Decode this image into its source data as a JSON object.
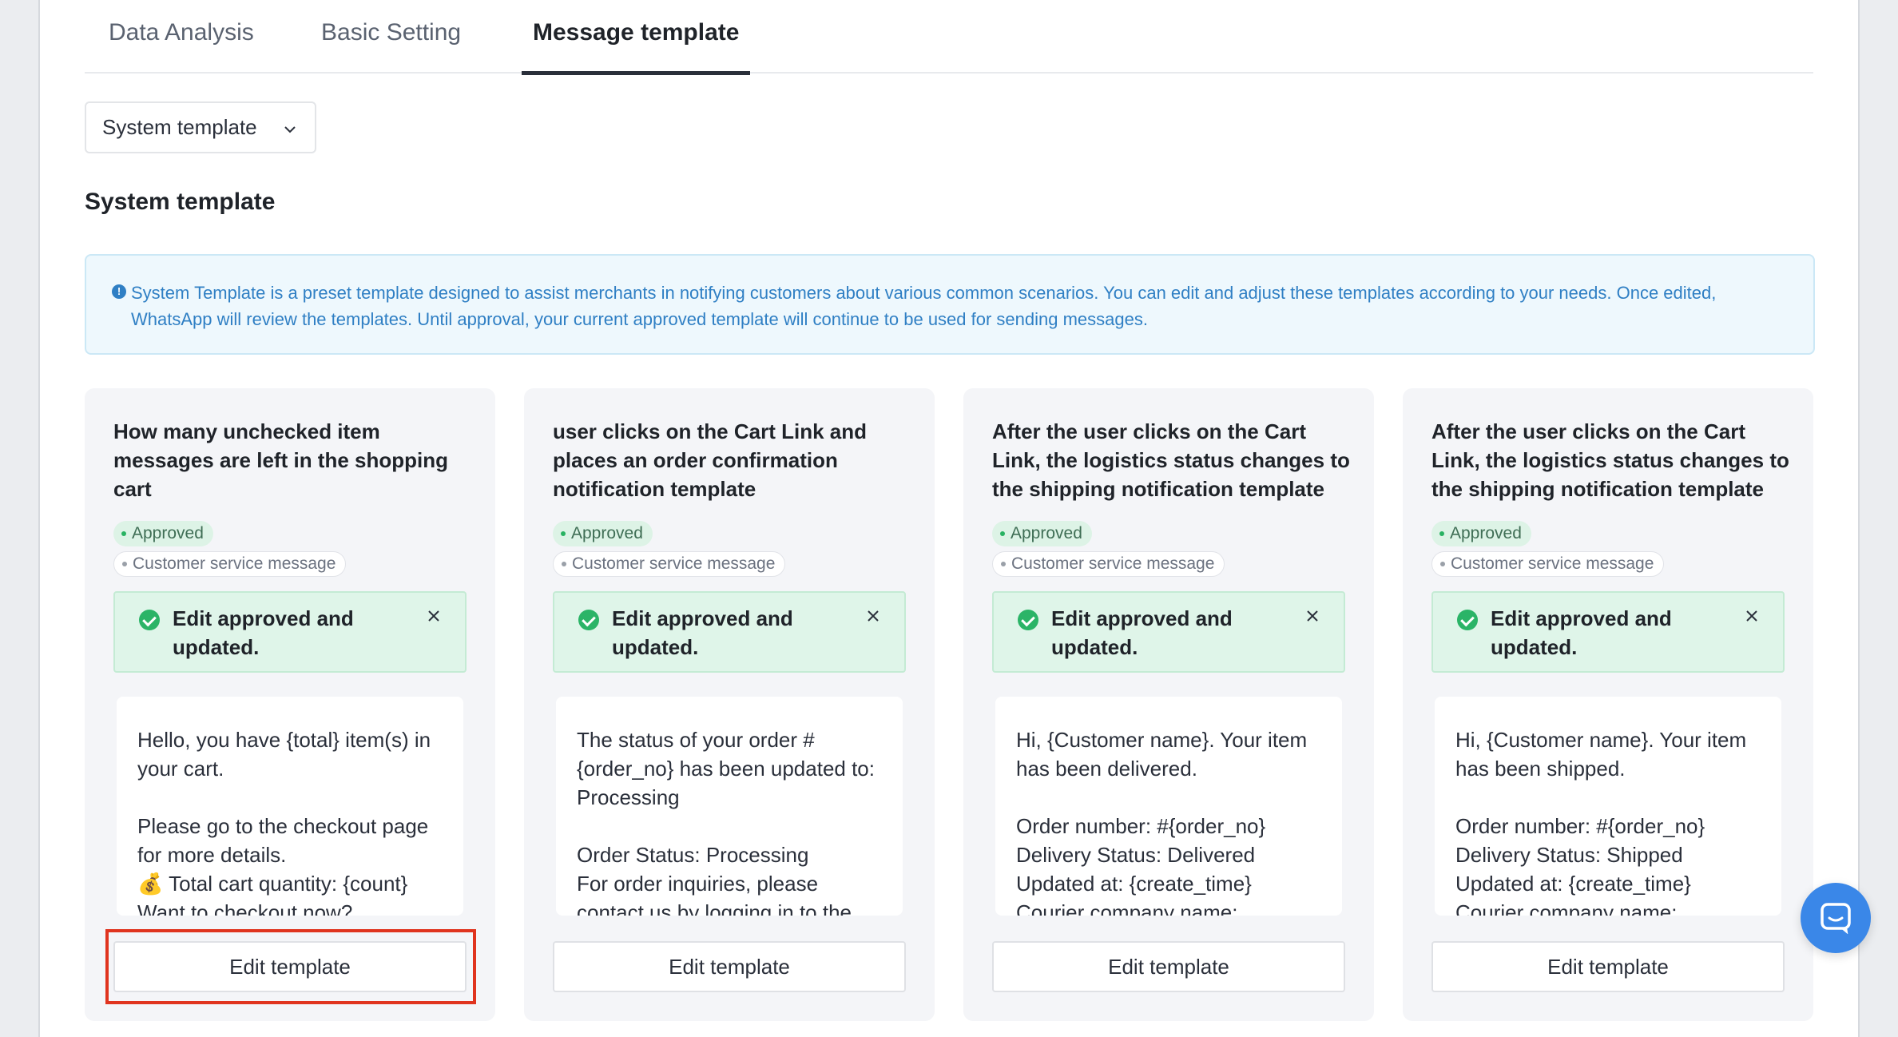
{
  "tabs": [
    {
      "label": "Data Analysis"
    },
    {
      "label": "Basic Setting"
    },
    {
      "label": "Message template"
    }
  ],
  "active_tab": "Message template",
  "template_select": {
    "value": "System template"
  },
  "section_title": "System template",
  "notice": {
    "text": "System Template is a preset template designed to assist merchants in notifying customers about various common scenarios. You can edit and adjust these templates according to your needs. Once edited, WhatsApp will review the templates. Until approval, your current approved template will continue to be used for sending messages."
  },
  "cards": [
    {
      "title": "How many unchecked item messages are left in the shopping cart",
      "status_tag": "Approved",
      "category_tag": "Customer service message",
      "alert": "Edit approved and updated.",
      "message": "Hello, you have {total} item(s) in your cart.\n\nPlease go to the checkout page for more details.\n💰 Total cart quantity: {count}\nWant to checkout now?",
      "button": "Edit template"
    },
    {
      "title": "user clicks on the Cart Link and places an order confirmation notification template",
      "status_tag": "Approved",
      "category_tag": "Customer service message",
      "alert": "Edit approved and updated.",
      "message": "The status of your order #{order_no} has been updated to: Processing\n\nOrder Status: Processing\nFor order inquiries, please contact us by logging in to the",
      "button": "Edit template"
    },
    {
      "title": "After the user clicks on the Cart Link, the logistics status changes to the shipping notification template",
      "status_tag": "Approved",
      "category_tag": "Customer service message",
      "alert": "Edit approved and updated.",
      "message": "Hi, {Customer name}. Your item has been delivered.\n\nOrder number: #{order_no}\nDelivery Status: Delivered\nUpdated at: {create_time}\nCourier company name:",
      "button": "Edit template"
    },
    {
      "title": "After the user clicks on the Cart Link, the logistics status changes to the shipping notification template",
      "status_tag": "Approved",
      "category_tag": "Customer service message",
      "alert": "Edit approved and updated.",
      "message": "Hi, {Customer name}. Your item has been shipped.\n\nOrder number: #{order_no}\nDelivery Status: Shipped\nUpdated at: {create_time}\nCourier company name:",
      "button": "Edit template"
    }
  ],
  "colors": {
    "accent_highlight": "#e0341f",
    "approved_green": "#2bb467",
    "info_blue": "#2f7fc4",
    "chat_button": "#3a87e8"
  },
  "icons": {
    "dropdown": "chevron-down-icon",
    "notice": "info-icon",
    "alert": "check-circle-icon",
    "alert_close": "close-icon",
    "chat": "chat-bubble-icon"
  }
}
